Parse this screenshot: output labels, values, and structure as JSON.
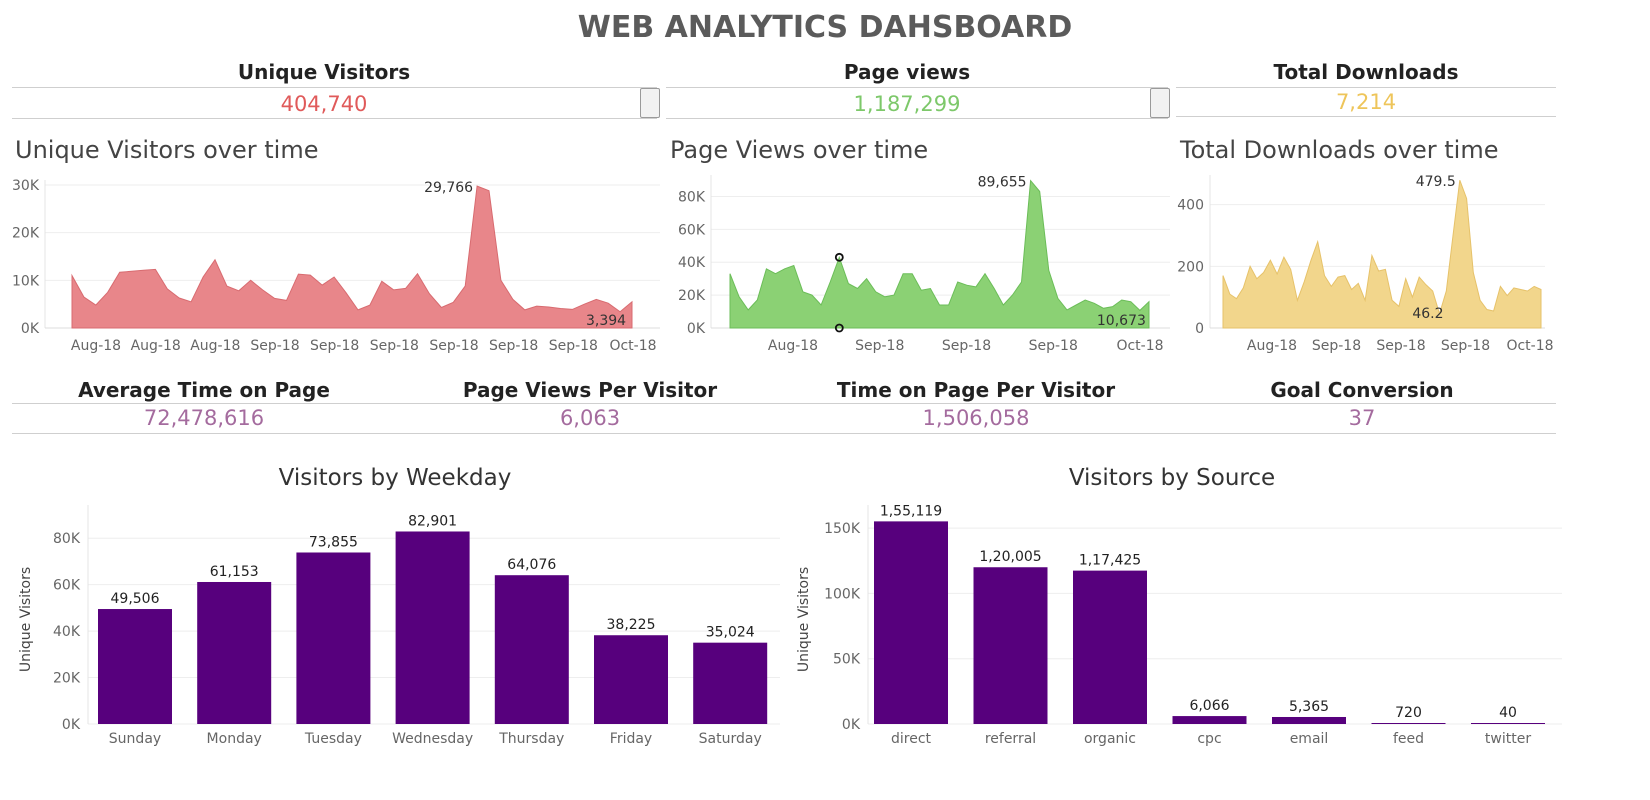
{
  "header": {
    "title": "WEB ANALYTICS DAHSBOARD"
  },
  "kpis_top": [
    {
      "label": "Unique Visitors",
      "value": "404,740",
      "color": "#e05a5a"
    },
    {
      "label": "Page views",
      "value": "1,187,299",
      "color": "#7dc86a"
    },
    {
      "label": "Total Downloads",
      "value": "7,214",
      "color": "#eec55a"
    }
  ],
  "kpis_mid": [
    {
      "label": "Average Time on Page",
      "value": "72,478,616",
      "color": "#a46b9e"
    },
    {
      "label": "Page Views Per Visitor",
      "value": "6,063",
      "color": "#a46b9e"
    },
    {
      "label": "Time on Page Per Visitor",
      "value": "1,506,058",
      "color": "#a46b9e"
    },
    {
      "label": "Goal Conversion",
      "value": "37",
      "color": "#a46b9e"
    }
  ],
  "chart_titles": {
    "uv": "Unique Visitors over time",
    "pv": "Page Views over time",
    "dl": "Total Downloads over time",
    "weekday": "Visitors by Weekday",
    "source": "Visitors by Source"
  },
  "chart_data": [
    {
      "type": "area",
      "id": "uv",
      "title": "Unique Visitors over time",
      "color": "#e8868a",
      "ylim": [
        0,
        30000
      ],
      "yticks": [
        0,
        10000,
        20000,
        30000
      ],
      "ytick_labels": [
        "0K",
        "10K",
        "20K",
        "30K"
      ],
      "xtick_labels": [
        "Aug-18",
        "Aug-18",
        "Aug-18",
        "Sep-18",
        "Sep-18",
        "Sep-18",
        "Sep-18",
        "Sep-18",
        "Sep-18",
        "Oct-18"
      ],
      "values": [
        11000,
        6500,
        4800,
        7500,
        11700,
        11900,
        12100,
        12300,
        8200,
        6300,
        5500,
        10700,
        14300,
        8800,
        7800,
        10000,
        8000,
        6200,
        5800,
        11300,
        11100,
        9000,
        10700,
        7400,
        3800,
        4800,
        9800,
        8000,
        8300,
        11400,
        7200,
        4300,
        5400,
        8800,
        29766,
        28800,
        10000,
        6000,
        3800,
        4600,
        4400,
        4100,
        3900,
        5000,
        6000,
        5200,
        3394,
        5500
      ],
      "annotations": [
        {
          "index": 34,
          "label": "29,766"
        },
        {
          "index": 46,
          "label": "3,394"
        }
      ]
    },
    {
      "type": "area",
      "id": "pv",
      "title": "Page Views over time",
      "color": "#8bd174",
      "ylim": [
        0,
        90000
      ],
      "yticks": [
        0,
        20000,
        40000,
        60000,
        80000
      ],
      "ytick_labels": [
        "0K",
        "20K",
        "40K",
        "60K",
        "80K"
      ],
      "xtick_labels": [
        "Aug-18",
        "Sep-18",
        "Sep-18",
        "Sep-18",
        "Oct-18"
      ],
      "values": [
        33000,
        19000,
        11000,
        17000,
        36000,
        33000,
        36000,
        38000,
        22000,
        20000,
        14000,
        28000,
        43000,
        27000,
        24000,
        30000,
        22000,
        19000,
        20000,
        33000,
        33000,
        23000,
        24000,
        14000,
        14000,
        28000,
        26000,
        25000,
        33000,
        24000,
        14000,
        20000,
        28000,
        89655,
        83000,
        35000,
        18000,
        11000,
        14000,
        17000,
        15000,
        12000,
        13000,
        17000,
        16000,
        10673,
        16000
      ],
      "annotations": [
        {
          "index": 33,
          "label": "89,655"
        },
        {
          "index": 45,
          "label": "10,673"
        }
      ]
    },
    {
      "type": "area",
      "id": "dl",
      "title": "Total Downloads over time",
      "color": "#f2d68c",
      "ylim": [
        0,
        480
      ],
      "yticks": [
        0,
        200,
        400
      ],
      "ytick_labels": [
        "0",
        "200",
        "400"
      ],
      "xtick_labels": [
        "Aug-18",
        "Sep-18",
        "Sep-18",
        "Sep-18",
        "Oct-18"
      ],
      "values": [
        170,
        110,
        95,
        130,
        200,
        160,
        180,
        220,
        175,
        230,
        190,
        90,
        150,
        220,
        280,
        170,
        135,
        165,
        170,
        125,
        145,
        90,
        235,
        185,
        190,
        90,
        70,
        160,
        100,
        165,
        140,
        120,
        46.2,
        120,
        300,
        479.5,
        420,
        180,
        90,
        60,
        55,
        135,
        105,
        130,
        125,
        120,
        135,
        125
      ],
      "annotations": [
        {
          "index": 35,
          "label": "479.5"
        },
        {
          "index": 32,
          "label": "46.2"
        }
      ]
    },
    {
      "type": "bar",
      "id": "weekday",
      "title": "Visitors by Weekday",
      "ylabel": "Unique Visitors",
      "color": "#57007d",
      "categories": [
        "Sunday",
        "Monday",
        "Tuesday",
        "Wednesday",
        "Thursday",
        "Friday",
        "Saturday"
      ],
      "values": [
        49506,
        61153,
        73855,
        82901,
        64076,
        38225,
        35024
      ],
      "value_labels": [
        "49,506",
        "61,153",
        "73,855",
        "82,901",
        "64,076",
        "38,225",
        "35,024"
      ],
      "ylim": [
        0,
        90000
      ],
      "yticks": [
        0,
        20000,
        40000,
        60000,
        80000
      ],
      "ytick_labels": [
        "0K",
        "20K",
        "40K",
        "60K",
        "80K"
      ]
    },
    {
      "type": "bar",
      "id": "source",
      "title": "Visitors by Source",
      "ylabel": "Unique Visitors",
      "color": "#57007d",
      "categories": [
        "direct",
        "referral",
        "organic",
        "cpc",
        "email",
        "feed",
        "twitter"
      ],
      "values": [
        155119,
        120005,
        117425,
        6066,
        5365,
        720,
        40
      ],
      "value_labels": [
        "1,55,119",
        "1,20,005",
        "1,17,425",
        "6,066",
        "5,365",
        "720",
        "40"
      ],
      "ylim": [
        0,
        160000
      ],
      "yticks": [
        0,
        50000,
        100000,
        150000
      ],
      "ytick_labels": [
        "0K",
        "50K",
        "100K",
        "150K"
      ]
    }
  ]
}
